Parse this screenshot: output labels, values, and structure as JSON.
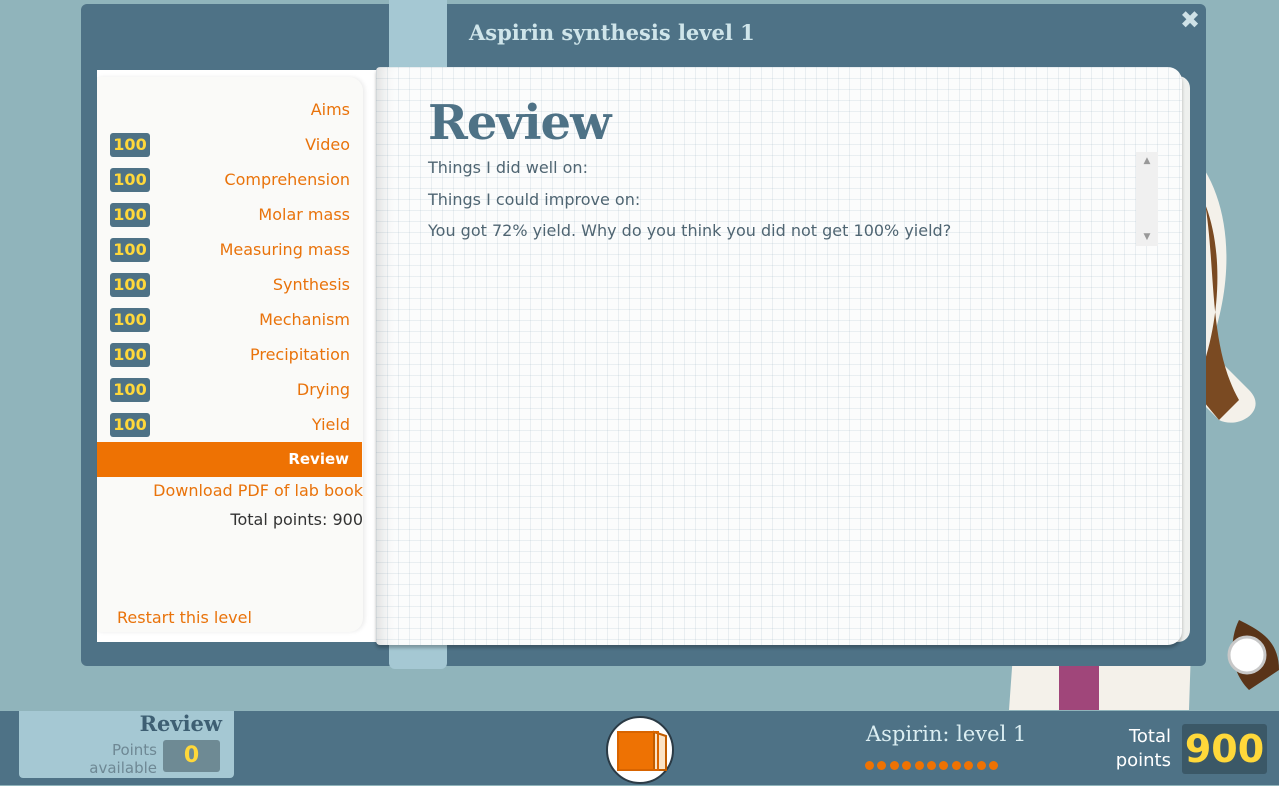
{
  "modal": {
    "title": "Aspirin synthesis level 1",
    "close_icon": "close-icon"
  },
  "sidebar": {
    "items": [
      {
        "label": "Aims",
        "score": null
      },
      {
        "label": "Video",
        "score": "100"
      },
      {
        "label": "Comprehension",
        "score": "100"
      },
      {
        "label": "Molar mass",
        "score": "100"
      },
      {
        "label": "Measuring mass",
        "score": "100"
      },
      {
        "label": "Synthesis",
        "score": "100"
      },
      {
        "label": "Mechanism",
        "score": "100"
      },
      {
        "label": "Precipitation",
        "score": "100"
      },
      {
        "label": "Drying",
        "score": "100"
      },
      {
        "label": "Yield",
        "score": "100"
      },
      {
        "label": "Review",
        "score": null,
        "active": true
      }
    ],
    "download_link": "Download PDF of lab book",
    "total_points_text": "Total points: 900",
    "restart_link": "Restart this level"
  },
  "review": {
    "heading": "Review",
    "lines": [
      "Things I did well on:",
      "Things I could improve on:",
      "You got 72% yield. Why do you think you did not get 100% yield?"
    ]
  },
  "bottom_bar": {
    "section_title": "Review",
    "points_available_label": "Points available",
    "points_available_value": "0",
    "book_icon": "notebook-icon",
    "level_name": "Aspirin: level 1",
    "progress_dots": 11,
    "total_label": "Total points",
    "total_value": "900"
  },
  "colors": {
    "accent": "#ee7203",
    "panel": "#4e7286",
    "badge_text": "#ffd83a",
    "background": "#90b4bb"
  }
}
